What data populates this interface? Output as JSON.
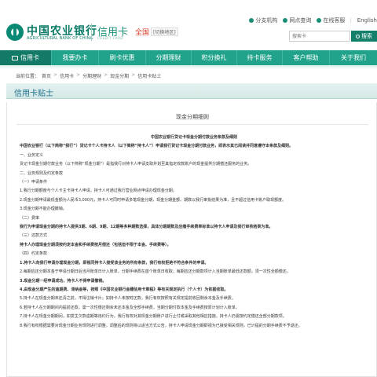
{
  "header": {
    "bank_name_cn": "中国农业银行",
    "bank_name_en": "AGRICULTURAL BANK OF CHINA",
    "credit_card_cn": "信用卡",
    "credit_card_en": "CREDIT CARD",
    "region": "全国",
    "region_switch": "[切换地区]",
    "top_links": [
      "分支机构",
      "网点查询",
      "在线客服",
      "English"
    ],
    "search_placeholder": "搜索卡",
    "search_button": "搜索"
  },
  "nav": {
    "items": [
      {
        "label": "信用卡",
        "active": true
      },
      {
        "label": "我要办卡"
      },
      {
        "label": "刷卡优惠"
      },
      {
        "label": "分期理财"
      },
      {
        "label": "积分换礼"
      },
      {
        "label": "持卡服务"
      },
      {
        "label": "客户帮助"
      },
      {
        "label": "关于我们"
      }
    ]
  },
  "breadcrumb": [
    "当前位置：",
    "首页",
    "信用卡",
    "分期理财",
    "现金分期",
    "信用卡贴士"
  ],
  "page_title": "信用卡贴士",
  "content": {
    "subtitle": "现金分期细则",
    "lines": [
      "中国农业银行贷记卡现金分期付款业务条款及细则",
      "中国农业银行（以下简称“我行”）贷记卡个人卡持卡人（以下简称“持卡人”）申请我行贷记卡现金分期付款业务，即表示其已阅读并同意遵守本条款及细则。",
      "一、业务定义",
      "贷记卡现金分期付款业务（以下简称“现金分期”）是指我行对持卡人申请支取并划至其指定收款账户的现金提供分期偿还服务的业务。",
      "二、业务规则及约定条款",
      "（一）申请条件",
      "1.我行分期额度与个人卡主卡持卡人申请，持卡人可通过我行营业网点申请办理现金分期。",
      "2.现金分期申请最低金额为人民币3,000元，持卡人可同时申请多笔现金分期，现金分期金额、期数以我行审批结果为准，且不超过信用卡账户取现额度。",
      "3.现金分期不能办理撤销。",
      "（二）费率",
      "我行为申请现金分期的持卡人提供3期、6期、9期、12期等多种期数选择，具体分期期数及应缴手续费率标准以持卡人申请及我行审核结果为准。",
      "（三）还款方式",
      "持卡人办理现金分期须按约定本金和手续费按月偿还（包括但不限于本金、手续费等）。",
      "（四）约定条款",
      "1.持卡人向我行申请办理现金分期，即视同持卡人接受该业务的所有条款，我行有权拒绝不符合条件的申请。",
      "2.每期应还分期本金于申请分期日后当月账单日计入账单，分期手续费在首个账单日收取；每期应还分期款项计入当期账单最低还款额，须一次性全额偿还。",
      "3.现金分期一经申请成功，持卡人不得申请撤销。",
      "4.由现金分期产生的逾期费、滞纳金等，按照《中国农业银行金穗信用卡章程》等有关规定执行（个人卡）为依据收取。",
      "5.持卡人在现金分期未还清之前，不得注销卡片；如持卡人未按时还款，我行有权按照有关规定提前收回剩余本金及手续费。",
      "6.若持卡人在分期期间内提前还款，需一次性偿还剩余未还本金及全部手续费，当期分期付款本金及手续费按原计划计入账单。",
      "7.持卡人在现金分期期间，如发生欠款逾期等违约行为，我行有权对其现金分期账户进行止付或采取其他相应措施，持卡人仍需按约定偿还全部分期款项。",
      "8.我行有权根据需要对现金分期业务规则进行调整，调整后的规则将以适当方式公告，持卡人申请现金分期即视为已接受相关规则，已计提的分期手续费不予退还。"
    ]
  }
}
